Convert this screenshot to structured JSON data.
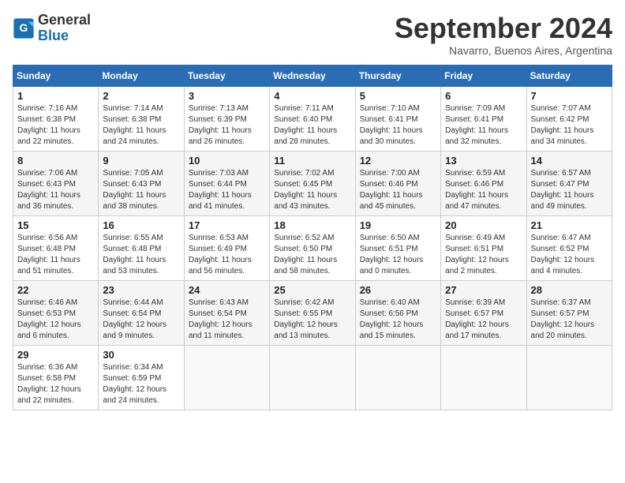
{
  "header": {
    "logo_general": "General",
    "logo_blue": "Blue",
    "title": "September 2024",
    "location": "Navarro, Buenos Aires, Argentina"
  },
  "calendar": {
    "days_of_week": [
      "Sunday",
      "Monday",
      "Tuesday",
      "Wednesday",
      "Thursday",
      "Friday",
      "Saturday"
    ],
    "weeks": [
      [
        {
          "day": "",
          "info": ""
        },
        {
          "day": "2",
          "info": "Sunrise: 7:14 AM\nSunset: 6:38 PM\nDaylight: 11 hours\nand 24 minutes."
        },
        {
          "day": "3",
          "info": "Sunrise: 7:13 AM\nSunset: 6:39 PM\nDaylight: 11 hours\nand 26 minutes."
        },
        {
          "day": "4",
          "info": "Sunrise: 7:11 AM\nSunset: 6:40 PM\nDaylight: 11 hours\nand 28 minutes."
        },
        {
          "day": "5",
          "info": "Sunrise: 7:10 AM\nSunset: 6:41 PM\nDaylight: 11 hours\nand 30 minutes."
        },
        {
          "day": "6",
          "info": "Sunrise: 7:09 AM\nSunset: 6:41 PM\nDaylight: 11 hours\nand 32 minutes."
        },
        {
          "day": "7",
          "info": "Sunrise: 7:07 AM\nSunset: 6:42 PM\nDaylight: 11 hours\nand 34 minutes."
        }
      ],
      [
        {
          "day": "1",
          "info": "Sunrise: 7:16 AM\nSunset: 6:38 PM\nDaylight: 11 hours\nand 22 minutes."
        },
        {
          "day": "9",
          "info": "Sunrise: 7:05 AM\nSunset: 6:43 PM\nDaylight: 11 hours\nand 38 minutes."
        },
        {
          "day": "10",
          "info": "Sunrise: 7:03 AM\nSunset: 6:44 PM\nDaylight: 11 hours\nand 41 minutes."
        },
        {
          "day": "11",
          "info": "Sunrise: 7:02 AM\nSunset: 6:45 PM\nDaylight: 11 hours\nand 43 minutes."
        },
        {
          "day": "12",
          "info": "Sunrise: 7:00 AM\nSunset: 6:46 PM\nDaylight: 11 hours\nand 45 minutes."
        },
        {
          "day": "13",
          "info": "Sunrise: 6:59 AM\nSunset: 6:46 PM\nDaylight: 11 hours\nand 47 minutes."
        },
        {
          "day": "14",
          "info": "Sunrise: 6:57 AM\nSunset: 6:47 PM\nDaylight: 11 hours\nand 49 minutes."
        }
      ],
      [
        {
          "day": "8",
          "info": "Sunrise: 7:06 AM\nSunset: 6:43 PM\nDaylight: 11 hours\nand 36 minutes."
        },
        {
          "day": "16",
          "info": "Sunrise: 6:55 AM\nSunset: 6:48 PM\nDaylight: 11 hours\nand 53 minutes."
        },
        {
          "day": "17",
          "info": "Sunrise: 6:53 AM\nSunset: 6:49 PM\nDaylight: 11 hours\nand 56 minutes."
        },
        {
          "day": "18",
          "info": "Sunrise: 6:52 AM\nSunset: 6:50 PM\nDaylight: 11 hours\nand 58 minutes."
        },
        {
          "day": "19",
          "info": "Sunrise: 6:50 AM\nSunset: 6:51 PM\nDaylight: 12 hours\nand 0 minutes."
        },
        {
          "day": "20",
          "info": "Sunrise: 6:49 AM\nSunset: 6:51 PM\nDaylight: 12 hours\nand 2 minutes."
        },
        {
          "day": "21",
          "info": "Sunrise: 6:47 AM\nSunset: 6:52 PM\nDaylight: 12 hours\nand 4 minutes."
        }
      ],
      [
        {
          "day": "15",
          "info": "Sunrise: 6:56 AM\nSunset: 6:48 PM\nDaylight: 11 hours\nand 51 minutes."
        },
        {
          "day": "23",
          "info": "Sunrise: 6:44 AM\nSunset: 6:54 PM\nDaylight: 12 hours\nand 9 minutes."
        },
        {
          "day": "24",
          "info": "Sunrise: 6:43 AM\nSunset: 6:54 PM\nDaylight: 12 hours\nand 11 minutes."
        },
        {
          "day": "25",
          "info": "Sunrise: 6:42 AM\nSunset: 6:55 PM\nDaylight: 12 hours\nand 13 minutes."
        },
        {
          "day": "26",
          "info": "Sunrise: 6:40 AM\nSunset: 6:56 PM\nDaylight: 12 hours\nand 15 minutes."
        },
        {
          "day": "27",
          "info": "Sunrise: 6:39 AM\nSunset: 6:57 PM\nDaylight: 12 hours\nand 17 minutes."
        },
        {
          "day": "28",
          "info": "Sunrise: 6:37 AM\nSunset: 6:57 PM\nDaylight: 12 hours\nand 20 minutes."
        }
      ],
      [
        {
          "day": "22",
          "info": "Sunrise: 6:46 AM\nSunset: 6:53 PM\nDaylight: 12 hours\nand 6 minutes."
        },
        {
          "day": "30",
          "info": "Sunrise: 6:34 AM\nSunset: 6:59 PM\nDaylight: 12 hours\nand 24 minutes."
        },
        {
          "day": "",
          "info": ""
        },
        {
          "day": "",
          "info": ""
        },
        {
          "day": "",
          "info": ""
        },
        {
          "day": "",
          "info": ""
        },
        {
          "day": "",
          "info": ""
        }
      ],
      [
        {
          "day": "29",
          "info": "Sunrise: 6:36 AM\nSunset: 6:58 PM\nDaylight: 12 hours\nand 22 minutes."
        },
        {
          "day": "",
          "info": ""
        },
        {
          "day": "",
          "info": ""
        },
        {
          "day": "",
          "info": ""
        },
        {
          "day": "",
          "info": ""
        },
        {
          "day": "",
          "info": ""
        },
        {
          "day": "",
          "info": ""
        }
      ]
    ]
  }
}
